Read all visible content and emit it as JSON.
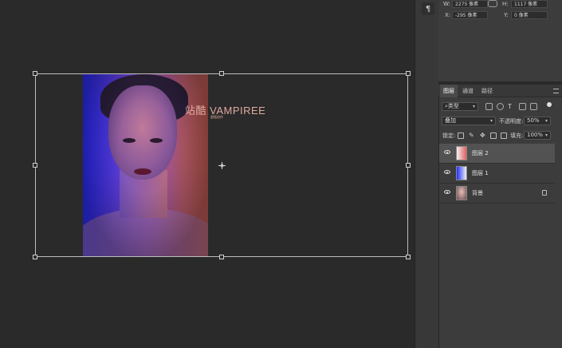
{
  "canvas": {
    "overlay_title": "站酷 VAMPIREE",
    "overlay_subtitle": "超瓶创作"
  },
  "properties": {
    "w_label": "W:",
    "w_value": "2275 像素",
    "h_label": "H:",
    "h_value": "1117 像素",
    "x_label": "X:",
    "x_value": "-295 像素",
    "y_label": "Y:",
    "y_value": "0 像素"
  },
  "layers_panel": {
    "tabs": [
      {
        "label": "图层",
        "active": true
      },
      {
        "label": "通道",
        "active": false
      },
      {
        "label": "路径",
        "active": false
      }
    ],
    "filter_kind": "类型",
    "blend_mode": "叠加",
    "opacity_label": "不透明度:",
    "opacity_value": "50%",
    "lock_label": "锁定:",
    "fill_label": "填充:",
    "fill_value": "100%",
    "layers": [
      {
        "name": "图层 2",
        "selected": true,
        "locked": false,
        "thumb": "gradient-red"
      },
      {
        "name": "图层 1",
        "selected": false,
        "locked": false,
        "thumb": "gradient-blue"
      },
      {
        "name": "背景",
        "selected": false,
        "locked": true,
        "thumb": "portrait"
      }
    ]
  },
  "colors": {
    "overlay_text": "#e0a9a0",
    "panel_bg": "#3c3c3c",
    "canvas_bg": "#2a2a2a"
  }
}
